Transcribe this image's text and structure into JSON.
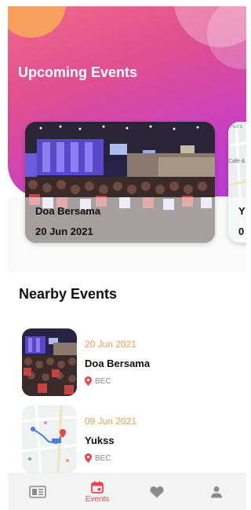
{
  "hero": {
    "title": "Upcoming Events"
  },
  "upcoming": [
    {
      "name": "Doa Bersama",
      "date": "20 Jun 2021"
    },
    {
      "name": "Y",
      "date": "0",
      "map_text_1": "Not b",
      "map_text_2": "Cafe &"
    }
  ],
  "nearby": {
    "title": "Nearby Events",
    "items": [
      {
        "date": "20 Jun 2021",
        "name": "Doa Bersama",
        "location": "BEC",
        "thumb_icon": "concert-photo"
      },
      {
        "date": "09 Jun 2021",
        "name": "Yukss",
        "location": "BEC",
        "thumb_icon": "map-thumbnail"
      }
    ]
  },
  "nav": {
    "items": [
      {
        "icon": "news-icon",
        "label": ""
      },
      {
        "icon": "calendar-icon",
        "label": "Events"
      },
      {
        "icon": "heart-icon",
        "label": ""
      },
      {
        "icon": "profile-icon",
        "label": ""
      }
    ]
  },
  "colors": {
    "accent": "#e8454f",
    "date_orange": "#f29a55",
    "gradient_start": "#f06a8a",
    "gradient_end": "#b43ad6",
    "orange_circle": "#f6a35c"
  }
}
